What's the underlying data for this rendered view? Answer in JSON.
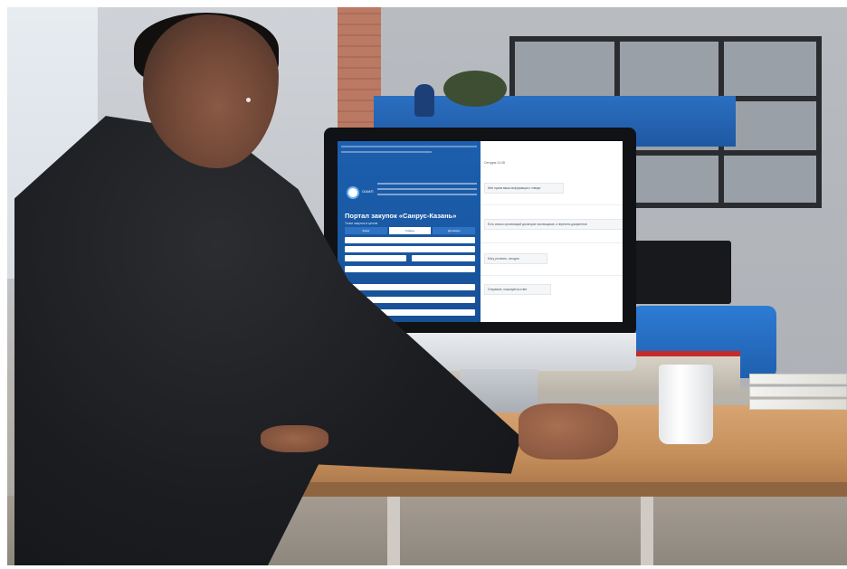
{
  "scene": {
    "description_free": true
  },
  "monitor_screen": {
    "portal_title": "Портал закупок «Санрус-Казань»",
    "portal_subtitle": "Точки закупок в целом",
    "logo_text": "ОАМП",
    "tabs": [
      "Заказ",
      "Товары",
      "Договоры"
    ],
    "chat_header": "Сегодня 11:45",
    "chat_messages": [
      "Мне нужна ваша информация о товаре",
      "Есть список организаций договоров поставщиков, и перечень документов",
      "Могу уточнить, сегодня",
      "Отправьте, пожалуйста ответ"
    ]
  },
  "colors": {
    "site_blue": "#1c5fae",
    "accent_red": "#c52b2b",
    "desk_wood": "#c48e5a"
  }
}
